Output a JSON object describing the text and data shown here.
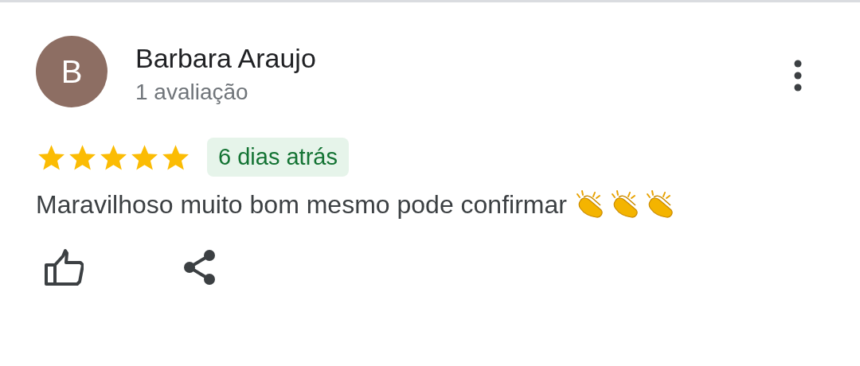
{
  "review": {
    "avatar_letter": "B",
    "author": "Barbara Araujo",
    "subtitle": "1 avaliação",
    "stars": 5,
    "date": "6 dias atrás",
    "text": "Maravilhoso muito bom mesmo pode confirmar"
  }
}
